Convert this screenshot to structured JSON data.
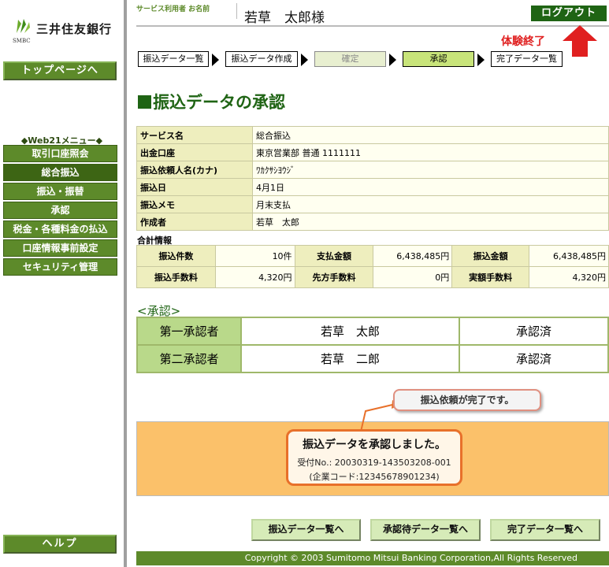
{
  "brand": {
    "name": "三井住友銀行",
    "sub": "SMBC"
  },
  "sidebar": {
    "top_button": "トップページへ",
    "menu_title": "◆Web21メニュー◆",
    "items": [
      {
        "label": "取引口座照会"
      },
      {
        "label": "総合振込",
        "active": true
      },
      {
        "label": "振込・振替"
      },
      {
        "label": "承認"
      },
      {
        "label": "税金・各種料金の払込"
      },
      {
        "label": "口座情報事前設定"
      },
      {
        "label": "セキュリティ管理"
      }
    ],
    "help_button": "ヘルプ"
  },
  "header": {
    "user_label": "サービス利用者 お名前",
    "user_name": "若草　太郎様",
    "logout_button": "ログアウト",
    "experience_end": "体験終了"
  },
  "steps": [
    {
      "label": "振込データ一覧"
    },
    {
      "label": "振込データ作成"
    },
    {
      "label": "確定",
      "state": "dim"
    },
    {
      "label": "承認",
      "state": "current"
    },
    {
      "label": "完了データ一覧"
    }
  ],
  "page_title": "振込データの承認",
  "info": {
    "rows": [
      {
        "key": "サービス名",
        "value": "総合振込"
      },
      {
        "key": "出金口座",
        "value": "東京営業部 普通 1111111"
      },
      {
        "key": "振込依頼人名(カナ)",
        "value": "ﾜｶｸｻｼﾖｳｼﾞ"
      },
      {
        "key": "振込日",
        "value": "4月1日"
      },
      {
        "key": "振込メモ",
        "value": "月末支払"
      },
      {
        "key": "作成者",
        "value": "若草　太郎"
      }
    ]
  },
  "summary": {
    "title": "合計情報",
    "row1": [
      {
        "key": "振込件数",
        "value": "10件"
      },
      {
        "key": "支払金額",
        "value": "6,438,485円"
      },
      {
        "key": "振込金額",
        "value": "6,438,485円"
      }
    ],
    "row2": [
      {
        "key": "振込手数料",
        "value": "4,320円"
      },
      {
        "key": "先方手数料",
        "value": "0円"
      },
      {
        "key": "実額手数料",
        "value": "4,320円"
      }
    ]
  },
  "approval": {
    "title": "<承認>",
    "rows": [
      {
        "role": "第一承認者",
        "name": "若草　太郎",
        "status": "承認済"
      },
      {
        "role": "第二承認者",
        "name": "若草　二郎",
        "status": "承認済"
      }
    ]
  },
  "result": {
    "bubble": "振込依頼が完了です。",
    "message": "振込データを承認しました。",
    "receipt": "受付No.: 20030319-143503208-001",
    "company_code": "(企業コード:12345678901234)"
  },
  "buttons": {
    "transfer_list": "振込データ一覧へ",
    "pending_list": "承認待データ一覧へ",
    "completed_list": "完了データ一覧へ"
  },
  "footer": "Copyright © 2003 Sumitomo Mitsui Banking Corporation,All Rights Reserved",
  "colors": {
    "brand_green": "#1f6414",
    "menu_green": "#5d8a2a",
    "result_bg": "#fbc16a",
    "accent_red": "#e02020"
  }
}
